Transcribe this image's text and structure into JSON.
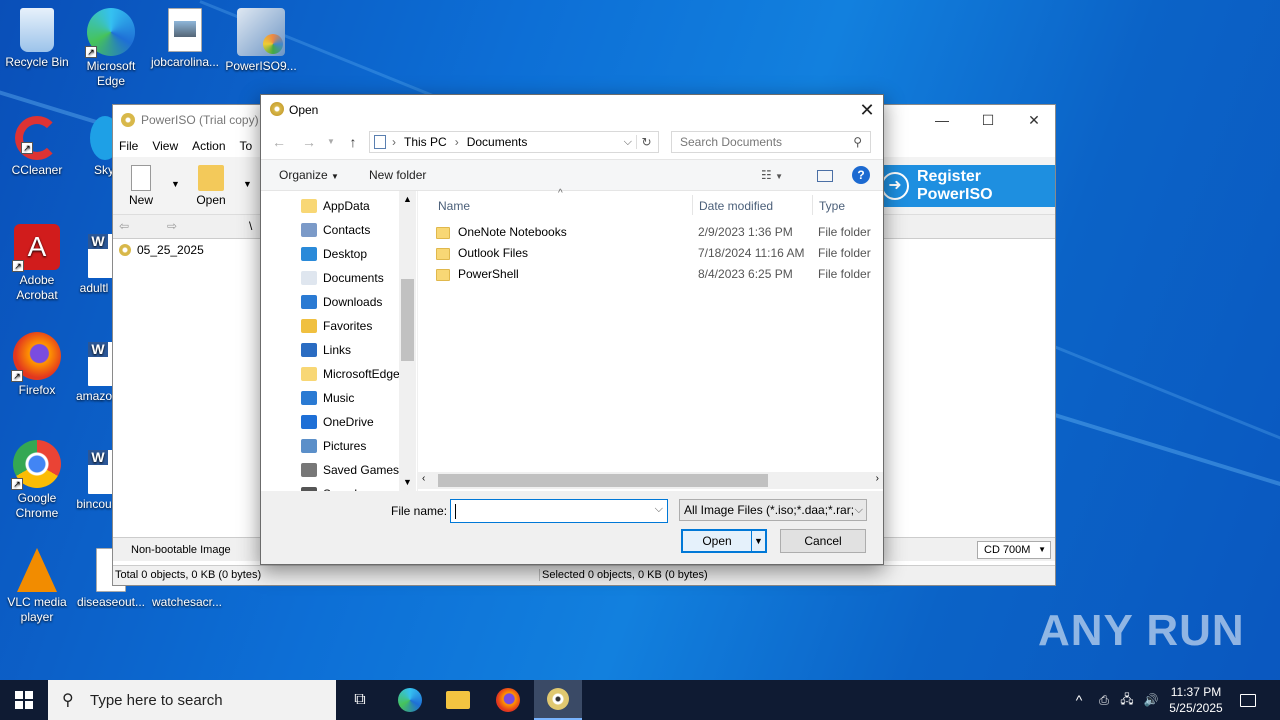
{
  "desktop": {
    "icons": [
      {
        "label": "Recycle Bin"
      },
      {
        "label": "Microsoft Edge"
      },
      {
        "label": "jobcarolina..."
      },
      {
        "label": "PowerISO9..."
      },
      {
        "label": "CCleaner"
      },
      {
        "label": "Sky"
      },
      {
        "label": "Adobe Acrobat"
      },
      {
        "label": "adultl"
      },
      {
        "label": "Firefox"
      },
      {
        "label": "amazo"
      },
      {
        "label": "Google Chrome"
      },
      {
        "label": "bincou"
      },
      {
        "label": "VLC media player"
      },
      {
        "label": "diseaseout..."
      },
      {
        "label": "watchesacr..."
      }
    ]
  },
  "poweriso": {
    "title": "PowerISO (Trial copy) -",
    "menu": [
      "File",
      "View",
      "Action",
      "To"
    ],
    "toolbar": {
      "new_label": "New",
      "open_label": "Open"
    },
    "path": "\\",
    "tree_item": "05_25_2025",
    "register_label": "Register PowerISO",
    "boot_status": "Non-bootable Image",
    "media": "CD 700M",
    "status_total": "Total 0 objects, 0 KB (0 bytes)",
    "status_selected": "Selected 0 objects, 0 KB (0 bytes)"
  },
  "dialog": {
    "title": "Open",
    "breadcrumb": [
      "This PC",
      "Documents"
    ],
    "search_placeholder": "Search Documents",
    "organize_label": "Organize",
    "new_folder_label": "New folder",
    "nav_items": [
      {
        "label": "AppData",
        "icon": "folder-icon"
      },
      {
        "label": "Contacts",
        "icon": "contacts-icon"
      },
      {
        "label": "Desktop",
        "icon": "desktop-icon"
      },
      {
        "label": "Documents",
        "icon": "documents-icon"
      },
      {
        "label": "Downloads",
        "icon": "downloads-icon"
      },
      {
        "label": "Favorites",
        "icon": "star-icon"
      },
      {
        "label": "Links",
        "icon": "links-icon"
      },
      {
        "label": "MicrosoftEdge",
        "icon": "folder-icon"
      },
      {
        "label": "Music",
        "icon": "music-icon"
      },
      {
        "label": "OneDrive",
        "icon": "onedrive-icon"
      },
      {
        "label": "Pictures",
        "icon": "pictures-icon"
      },
      {
        "label": "Saved Games",
        "icon": "games-icon"
      },
      {
        "label": "Searches",
        "icon": "search-icon"
      }
    ],
    "columns": {
      "name": "Name",
      "date": "Date modified",
      "type": "Type"
    },
    "files": [
      {
        "name": "OneNote Notebooks",
        "date": "2/9/2023 1:36 PM",
        "type": "File folder"
      },
      {
        "name": "Outlook Files",
        "date": "7/18/2024 11:16 AM",
        "type": "File folder"
      },
      {
        "name": "PowerShell",
        "date": "8/4/2023 6:25 PM",
        "type": "File folder"
      }
    ],
    "file_name_label": "File name:",
    "file_name_value": "",
    "file_type": "All Image Files (*.iso;*.daa;*.rar;",
    "open_button": "Open",
    "cancel_button": "Cancel"
  },
  "taskbar": {
    "search_placeholder": "Type here to search",
    "time": "11:37 PM",
    "date": "5/25/2025"
  },
  "watermark": "ANY RUN",
  "colors": {
    "accent": "#0078d7",
    "register": "#1e8fe0",
    "taskbar": "#0f1b33"
  }
}
